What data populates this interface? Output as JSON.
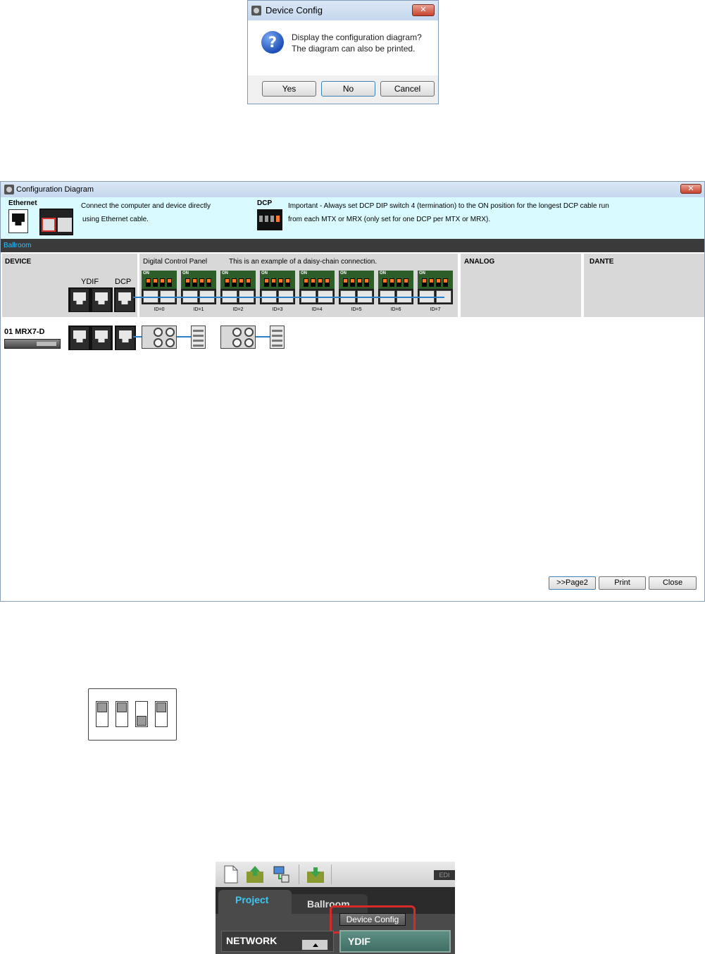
{
  "dialog": {
    "title": "Device Config",
    "message_line1": "Display the configuration diagram?",
    "message_line2": "The diagram can also be printed.",
    "close_glyph": "✕",
    "question_glyph": "?",
    "buttons": {
      "yes": "Yes",
      "no": "No",
      "cancel": "Cancel"
    }
  },
  "config_diagram": {
    "title": "Configuration Diagram",
    "close_glyph": "✕",
    "ethernet": {
      "heading": "Ethernet",
      "text_line1": "Connect the computer and device directly",
      "text_line2": "using Ethernet cable."
    },
    "dcp_info": {
      "heading": "DCP",
      "text_line1": "Important - Always set DCP DIP switch 4 (termination) to the ON position for the longest DCP cable run",
      "text_line2": "from each MTX or MRX (only set for one DCP per MTX or MRX)."
    },
    "room_label": "Ballroom",
    "columns": {
      "device": "DEVICE",
      "dcp_panel": "Digital  Control  Panel",
      "dcp_note": "This is an example of a daisy-chain connection.",
      "analog": "ANALOG",
      "dante": "DANTE"
    },
    "port_labels": {
      "ydif": "YDIF",
      "dcp": "DCP"
    },
    "panel_ids": [
      "ID=0",
      "ID=1",
      "ID=2",
      "ID=3",
      "ID=4",
      "ID=5",
      "ID=6",
      "ID=7"
    ],
    "device_row": {
      "name": "01 MRX7-D"
    },
    "buttons": {
      "page2": ">>Page2",
      "print": "Print",
      "close": "Close"
    }
  },
  "dip_switch": {
    "switch_positions": [
      "up",
      "up",
      "down",
      "up"
    ]
  },
  "toolbar": {
    "icons": [
      "new-file-icon",
      "open-folder-icon",
      "network-computer-icon",
      "save-folder-icon"
    ],
    "edit_label": "EDI",
    "tabs": [
      "Project",
      "Ballroom"
    ],
    "device_config_button": "Device Config",
    "network_label": "NETWORK",
    "ydif_label": "YDIF"
  }
}
